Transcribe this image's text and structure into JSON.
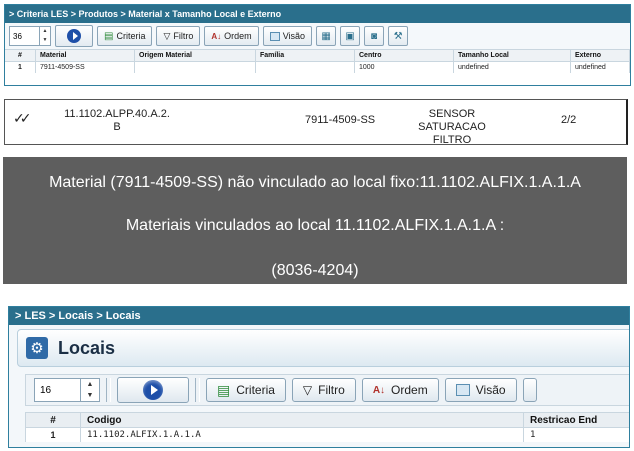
{
  "panel1": {
    "breadcrumb": "> Criteria LES > Produtos > Material x Tamanho Local e Externo",
    "toolbar": {
      "page_size": "36",
      "criteria": "Criteria",
      "filtro": "Filtro",
      "ordem": "Ordem",
      "visao": "Visão"
    },
    "table": {
      "columns": [
        "#",
        "Material",
        "Origem Material",
        "Família",
        "Centro",
        "Tamanho Local",
        "Externo"
      ],
      "rows": [
        [
          "1",
          "7911-4509-SS",
          "",
          "",
          "1000",
          "undefined",
          "undefined"
        ]
      ]
    }
  },
  "panel2": {
    "check_glyph": "✓✓",
    "location": "11.1102.ALPP.40.A.2.",
    "location_line2": "B",
    "material": "7911-4509-SS",
    "description": "SENSOR SATURACAO",
    "description_line2": "FILTRO",
    "count": "2/2"
  },
  "panel3": {
    "line1": "Material (7911-4509-SS) não vinculado ao local fixo:11.1102.ALFIX.1.A.1.A",
    "line2": "Materiais vinculados ao local 11.1102.ALFIX.1.A.1.A :",
    "line3": "(8036-4204)"
  },
  "panel4": {
    "breadcrumb": "> LES > Locais > Locais",
    "title": "Locais",
    "toolbar": {
      "page_size": "16",
      "criteria": "Criteria",
      "filtro": "Filtro",
      "ordem": "Ordem",
      "visao": "Visão"
    },
    "table": {
      "columns": [
        "#",
        "Codigo",
        "Restricao End"
      ],
      "rows": [
        [
          "1",
          "11.1102.ALFIX.1.A.1.A",
          "1"
        ]
      ]
    }
  },
  "colors": {
    "header_teal": "#2a6f8c",
    "play_blue": "#1e4fa8",
    "message_gray": "#5e5e5e"
  }
}
